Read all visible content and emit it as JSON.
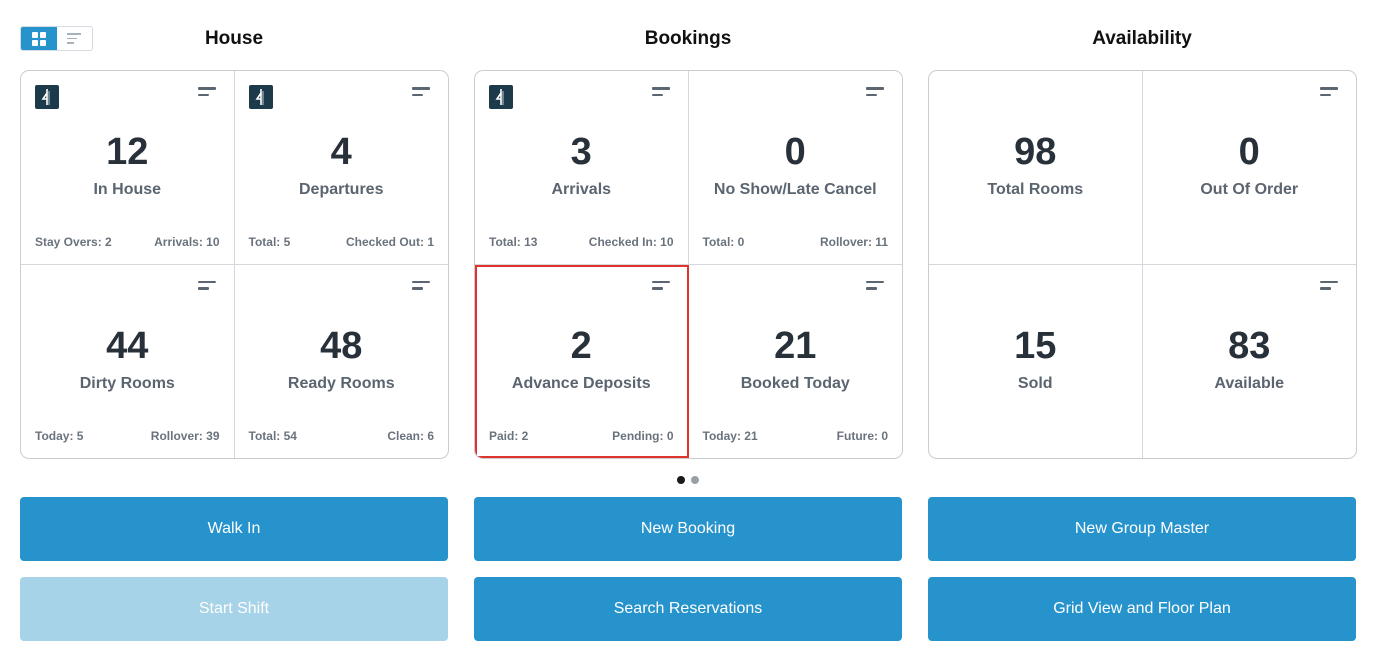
{
  "toolbar": {
    "grid_icon": "grid-view-icon",
    "list_icon": "list-view-icon"
  },
  "sections": {
    "house": "House",
    "bookings": "Bookings",
    "availability": "Availability"
  },
  "house_tiles": [
    {
      "value": "12",
      "label": "In House",
      "foot_left": "Stay Overs: 2",
      "foot_right": "Arrivals: 10"
    },
    {
      "value": "4",
      "label": "Departures",
      "foot_left": "Total: 5",
      "foot_right": "Checked Out: 1"
    },
    {
      "value": "44",
      "label": "Dirty Rooms",
      "foot_left": "Today: 5",
      "foot_right": "Rollover: 39"
    },
    {
      "value": "48",
      "label": "Ready Rooms",
      "foot_left": "Total: 54",
      "foot_right": "Clean: 6"
    }
  ],
  "booking_tiles": [
    {
      "value": "3",
      "label": "Arrivals",
      "foot_left": "Total: 13",
      "foot_right": "Checked In: 10"
    },
    {
      "value": "0",
      "label": "No Show/Late Cancel",
      "foot_left": "Total: 0",
      "foot_right": "Rollover: 11"
    },
    {
      "value": "2",
      "label": "Advance Deposits",
      "foot_left": "Paid: 2",
      "foot_right": "Pending: 0"
    },
    {
      "value": "21",
      "label": "Booked Today",
      "foot_left": "Today: 21",
      "foot_right": "Future: 0"
    }
  ],
  "availability_tiles": [
    {
      "value": "98",
      "label": "Total Rooms"
    },
    {
      "value": "0",
      "label": "Out Of Order"
    },
    {
      "value": "15",
      "label": "Sold"
    },
    {
      "value": "83",
      "label": "Available"
    }
  ],
  "buttons": {
    "walk_in": "Walk In",
    "start_shift": "Start Shift",
    "new_booking": "New Booking",
    "search_reservations": "Search Reservations",
    "new_group_master": "New Group Master",
    "grid_view_floor_plan": "Grid View and Floor Plan"
  },
  "colors": {
    "accent": "#2693cc",
    "accent_disabled": "#a6d3e8",
    "highlight": "#e0332d"
  }
}
